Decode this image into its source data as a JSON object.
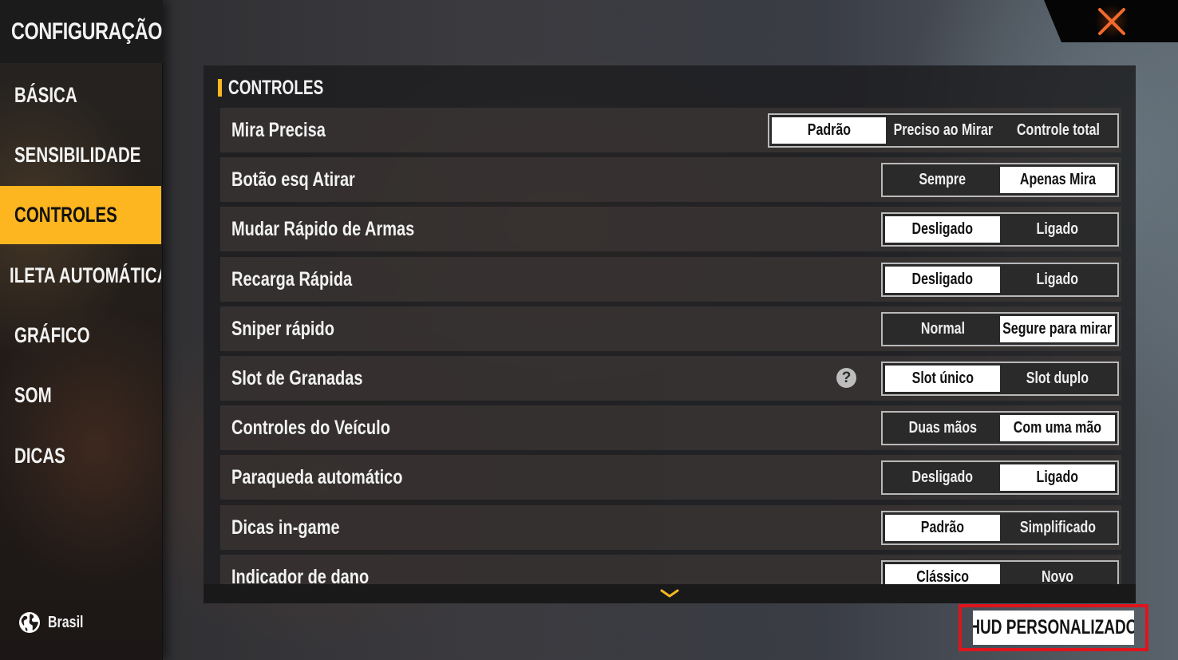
{
  "sidebar": {
    "title": "CONFIGURAÇÃO",
    "items": [
      {
        "label": "BÁSICA",
        "active": false
      },
      {
        "label": "SENSIBILIDADE",
        "active": false
      },
      {
        "label": "CONTROLES",
        "active": true
      },
      {
        "label": "ILETA AUTOMÁTICA",
        "active": false
      },
      {
        "label": "GRÁFICO",
        "active": false
      },
      {
        "label": "SOM",
        "active": false
      },
      {
        "label": "DICAS",
        "active": false
      }
    ],
    "region": {
      "icon": "globe-icon",
      "label": "Brasil"
    }
  },
  "close": {
    "icon": "close-icon",
    "color": "#f26a2b"
  },
  "panel": {
    "title": "CONTROLES",
    "accent": "#fdb520",
    "settings": [
      {
        "label": "Mira Precisa",
        "options": [
          "Padrão",
          "Preciso ao Mirar",
          "Controle total"
        ],
        "selected": 0
      },
      {
        "label": "Botão esq Atirar",
        "options": [
          "Sempre",
          "Apenas Mira"
        ],
        "selected": 1
      },
      {
        "label": "Mudar Rápido de Armas",
        "options": [
          "Desligado",
          "Ligado"
        ],
        "selected": 0
      },
      {
        "label": "Recarga Rápida",
        "options": [
          "Desligado",
          "Ligado"
        ],
        "selected": 0
      },
      {
        "label": "Sniper rápido",
        "options": [
          "Normal",
          "Segure para mirar"
        ],
        "selected": 1
      },
      {
        "label": "Slot de Granadas",
        "options": [
          "Slot único",
          "Slot duplo"
        ],
        "selected": 0,
        "help": true
      },
      {
        "label": "Controles do Veículo",
        "options": [
          "Duas mãos",
          "Com uma mão"
        ],
        "selected": 1
      },
      {
        "label": "Paraqueda automático",
        "options": [
          "Desligado",
          "Ligado"
        ],
        "selected": 1
      },
      {
        "label": "Dicas in-game",
        "options": [
          "Padrão",
          "Simplificado"
        ],
        "selected": 0
      },
      {
        "label": "Indicador de dano",
        "options": [
          "Clássico",
          "Novo"
        ],
        "selected": 0
      }
    ],
    "help_icon_glyph": "?",
    "scroll_icon": "chevron-down-icon"
  },
  "hud_button": {
    "label": "HUD PERSONALIZADO",
    "highlight_color": "#e0141c"
  }
}
